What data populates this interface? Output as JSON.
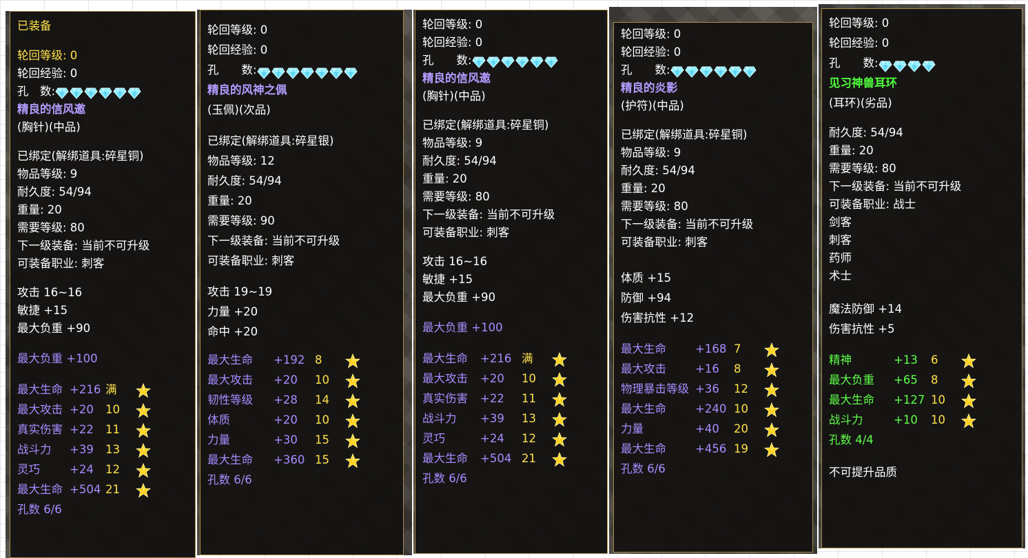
{
  "colors": {
    "white": "#ffffff",
    "yellow": "#ffe14a",
    "purple": "#a78cff",
    "green": "#5fff4a",
    "border": "#a88d4a"
  },
  "icons": {
    "gem": "diamond-gem-icon",
    "star": "gold-star-icon"
  },
  "tooltips": [
    {
      "header": "已装备",
      "rebirth_level": "轮回等级: 0",
      "rebirth_exp": "轮回经验: 0",
      "holes_label": "孔　数:",
      "gem_count": 6,
      "name": "精良的信风邀",
      "type": "(胸针)(中品)",
      "info": [
        "已绑定(解绑道具:碎星铜)",
        "物品等级: 9",
        "耐久度: 54/94",
        "重量: 20",
        "需要等级: 80",
        "下一级装备: 当前不可升级",
        "可装备职业: 刺客"
      ],
      "base": [
        "攻击 16~16",
        "敏捷 +15",
        "最大负重 +90"
      ],
      "extra": "最大负重 +100",
      "attrs": [
        [
          "最大生命",
          "+216",
          "满"
        ],
        [
          "最大攻击",
          "+20",
          "10"
        ],
        [
          "真实伤害",
          "+22",
          "11"
        ],
        [
          "战斗力",
          "+39",
          "13"
        ],
        [
          "灵巧",
          "+24",
          "12"
        ],
        [
          "最大生命",
          "+504",
          "21"
        ]
      ],
      "footer": "孔数 6/6"
    },
    {
      "rebirth_level": "轮回等级: 0",
      "rebirth_exp": "轮回经验: 0",
      "holes_label": "孔　　数:",
      "gem_count": 7,
      "name": "精良的风神之佩",
      "type": "(玉佩)(次品)",
      "info": [
        "已绑定(解绑道具:碎星银)",
        "物品等级: 12",
        "耐久度: 54/94",
        "重量: 20",
        "需要等级: 90",
        "下一级装备: 当前不可升级",
        "可装备职业: 刺客"
      ],
      "base": [
        "攻击 19~19",
        "力量 +20",
        "命中 +20"
      ],
      "attrs": [
        [
          "最大生命",
          "+192",
          "8"
        ],
        [
          "最大攻击",
          "+20",
          "10"
        ],
        [
          "韧性等级",
          "+28",
          "14"
        ],
        [
          "体质",
          "+20",
          "10"
        ],
        [
          "力量",
          "+30",
          "15"
        ],
        [
          "最大生命",
          "+360",
          "15"
        ]
      ],
      "footer": "孔数 6/6"
    },
    {
      "rebirth_level": "轮回等级: 0",
      "rebirth_exp": "轮回经验: 0",
      "holes_label": "孔　　数:",
      "gem_count": 6,
      "name": "精良的信风邀",
      "type": "(胸针)(中品)",
      "info": [
        "已绑定(解绑道具:碎星铜)",
        "物品等级: 9",
        "耐久度: 54/94",
        "重量: 20",
        "需要等级: 80",
        "下一级装备: 当前不可升级",
        "可装备职业: 刺客"
      ],
      "base": [
        "攻击 16~16",
        "敏捷 +15",
        "最大负重 +90"
      ],
      "extra": "最大负重 +100",
      "attrs": [
        [
          "最大生命",
          "+216",
          "满"
        ],
        [
          "最大攻击",
          "+20",
          "10"
        ],
        [
          "真实伤害",
          "+22",
          "11"
        ],
        [
          "战斗力",
          "+39",
          "13"
        ],
        [
          "灵巧",
          "+24",
          "12"
        ],
        [
          "最大生命",
          "+504",
          "21"
        ]
      ],
      "footer": "孔数 6/6"
    },
    {
      "rebirth_level": "轮回等级: 0",
      "rebirth_exp": "轮回经验: 0",
      "holes_label": "孔　　数:",
      "gem_count": 6,
      "name": "精良的炎影",
      "type": "(护符)(中品)",
      "info": [
        "已绑定(解绑道具:碎星铜)",
        "物品等级: 9",
        "耐久度: 54/94",
        "重量: 20",
        "需要等级: 80",
        "下一级装备: 当前不可升级",
        "可装备职业: 刺客"
      ],
      "base": [
        "体质 +15",
        "防御 +94",
        "伤害抗性 +12"
      ],
      "attrs": [
        [
          "最大生命",
          "+168",
          "7"
        ],
        [
          "最大攻击",
          "+16",
          "8"
        ],
        [
          "物理暴击等级",
          "+36",
          "12"
        ],
        [
          "最大生命",
          "+240",
          "10"
        ],
        [
          "力量",
          "+40",
          "20"
        ],
        [
          "最大生命",
          "+456",
          "19"
        ]
      ],
      "footer": "孔数 6/6"
    },
    {
      "rebirth_level": "轮回等级: 0",
      "rebirth_exp": "轮回经验: 0",
      "holes_label": "孔　　数:",
      "gem_count": 4,
      "name": "见习神兽耳环",
      "type": "(耳环)(劣品)",
      "info": [
        "耐久度: 54/94",
        "重量: 20",
        "需要等级: 80",
        "下一级装备: 当前不可升级",
        "可装备职业: 战士",
        "剑客",
        "刺客",
        "药师",
        "术士"
      ],
      "base": [
        "魔法防御 +14",
        "伤害抗性 +5"
      ],
      "attrs": [
        [
          "精神",
          "+13",
          "6"
        ],
        [
          "最大负重",
          "+65",
          "8"
        ],
        [
          "最大生命",
          "+127",
          "10"
        ],
        [
          "战斗力",
          "+10",
          "10"
        ]
      ],
      "footer": "孔数 4/4",
      "final": "不可提升品质"
    }
  ]
}
